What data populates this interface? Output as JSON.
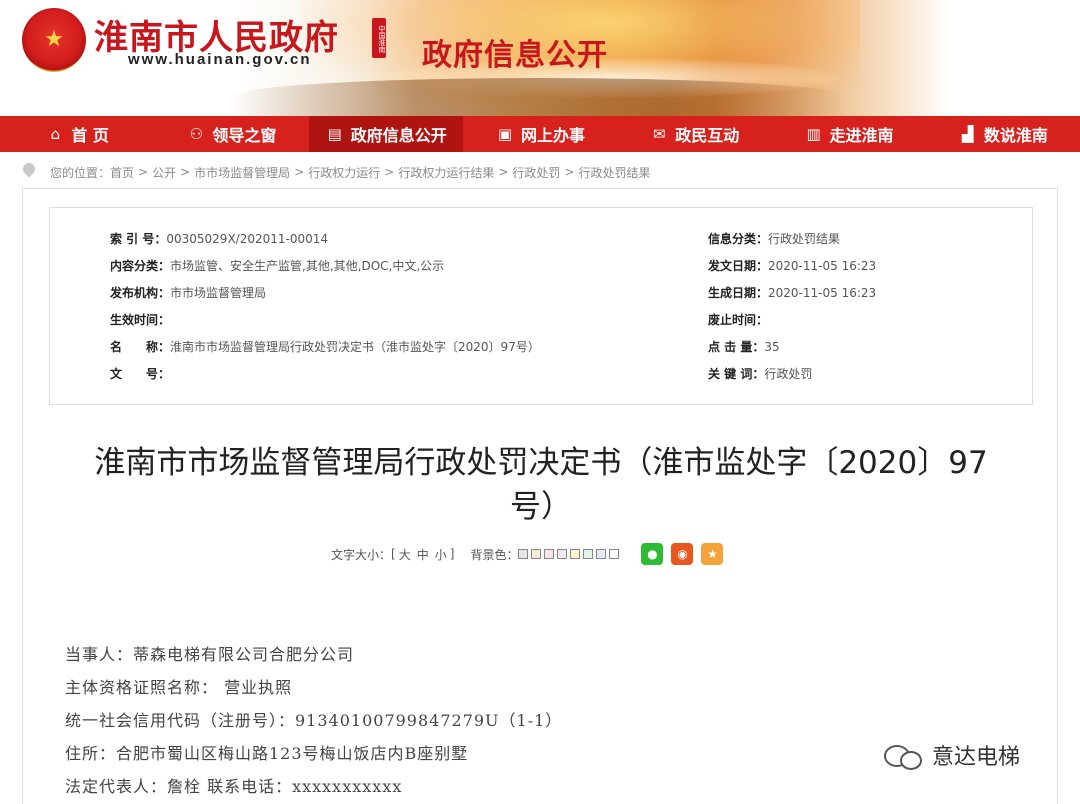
{
  "header": {
    "site_title": "淮南市人民政府",
    "site_url": "www.huainan.gov.cn",
    "seal_text": "中国淮南",
    "section_title": "政府信息公开"
  },
  "nav": {
    "items": [
      {
        "label": "首 页",
        "icon": "home-icon",
        "glyph": "⌂"
      },
      {
        "label": "领导之窗",
        "icon": "people-icon",
        "glyph": "⚇"
      },
      {
        "label": "政府信息公开",
        "icon": "document-icon",
        "glyph": "▤"
      },
      {
        "label": "网上办事",
        "icon": "monitor-icon",
        "glyph": "▣"
      },
      {
        "label": "政民互动",
        "icon": "chat-icon",
        "glyph": "✉"
      },
      {
        "label": "走进淮南",
        "icon": "book-icon",
        "glyph": "▥"
      },
      {
        "label": "数说淮南",
        "icon": "bar-chart-icon",
        "glyph": "▟"
      }
    ],
    "active_index": 2
  },
  "breadcrumb": {
    "prefix": "您的位置：",
    "items": [
      "首页",
      "公开",
      "市市场监督管理局",
      "行政权力运行",
      "行政权力运行结果",
      "行政处罚",
      "行政处罚结果"
    ],
    "separator": ">"
  },
  "meta": {
    "left": [
      {
        "key": "索 引 号：",
        "value": "00305029X/202011-00014"
      },
      {
        "key": "内容分类：",
        "value": "市场监管、安全生产监管,其他,其他,DOC,中文,公示"
      },
      {
        "key": "发布机构：",
        "value": "市市场监督管理局"
      },
      {
        "key": "生效时间：",
        "value": ""
      },
      {
        "key": "名　　称：",
        "value": "淮南市市场监督管理局行政处罚决定书（淮市监处字〔2020〕97号）"
      },
      {
        "key": "文　　号：",
        "value": ""
      }
    ],
    "right": [
      {
        "key": "信息分类：",
        "value": "行政处罚结果"
      },
      {
        "key": "发文日期：",
        "value": "2020-11-05 16:23"
      },
      {
        "key": "生成日期：",
        "value": "2020-11-05 16:23"
      },
      {
        "key": "废止时间：",
        "value": ""
      },
      {
        "key": "点 击 量：",
        "value": "35"
      },
      {
        "key": "关 键 词：",
        "value": "行政处罚"
      }
    ]
  },
  "document": {
    "title_line1": "淮南市市场监督管理局行政处罚决定书（淮市监处字〔2020〕97",
    "title_line2": "号）"
  },
  "tools": {
    "font_size_label": "文字大小：",
    "bracket_open": "[",
    "sizes": [
      "大",
      "中",
      "小"
    ],
    "bracket_close": "]",
    "bg_label": "背景色：",
    "bg_colors": [
      "#e6e6e6",
      "#f4ecd8",
      "#fbe3e3",
      "#f3e6f3",
      "#fff5cc",
      "#e3f3e3",
      "#e3e9f7",
      "#ffffff"
    ],
    "share": [
      {
        "name": "wechat-share-icon",
        "color": "#2dbb33",
        "glyph": "●"
      },
      {
        "name": "weibo-share-icon",
        "color": "#e8571d",
        "glyph": "◉"
      },
      {
        "name": "favorite-icon",
        "color": "#f3a33a",
        "glyph": "★"
      }
    ]
  },
  "body": {
    "lines": [
      "当事人：蒂森电梯有限公司合肥分公司",
      "主体资格证照名称： 营业执照",
      "统一社会信用代码（注册号）：91340100799847279U（1-1）",
      "住所：合肥市蜀山区梅山路123号梅山饭店内B座别墅",
      "法定代表人：詹栓          联系电话：xxxxxxxxxxx"
    ]
  },
  "watermark": {
    "text": "意达电梯"
  }
}
